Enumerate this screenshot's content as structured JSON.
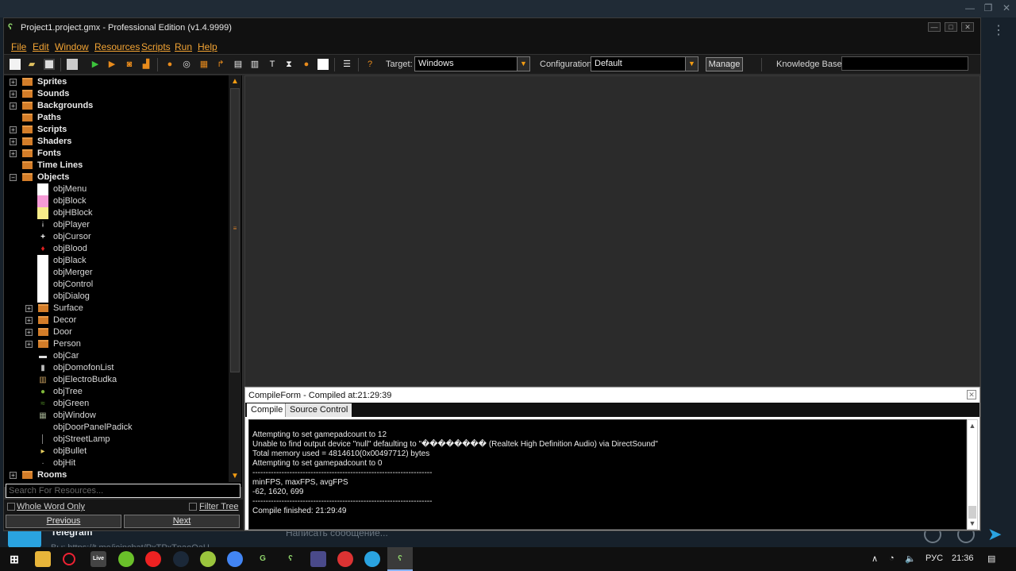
{
  "background_window": {
    "telegram_title": "Telegram",
    "telegram_link": "Вы: https://t.me/joinchat/PxTPxTpaoQaU",
    "message_placeholder": "Написать сообщение...",
    "control_minimize": "—",
    "control_maximize": "❐",
    "control_close": "✕",
    "kebab": "⋮",
    "send": "➤"
  },
  "gm_window": {
    "title": "Project1.project.gmx  -  Professional Edition (v1.4.9999)",
    "logo": "ʕ",
    "btn_minimize": "—",
    "btn_maximize": "□",
    "btn_close": "✕"
  },
  "menu": [
    "File",
    "Edit",
    "Window",
    "Resources",
    "Scripts",
    "Run",
    "Help"
  ],
  "toolbar": {
    "target_label": "Target:",
    "target_value": "Windows",
    "config_label": "Configuration:",
    "config_value": "Default",
    "manage_label": "Manage",
    "kb_label": "Knowledge Base:",
    "dropdown_arrow": "▼"
  },
  "tree": {
    "expand": "+",
    "collapse": "−",
    "folders": [
      "Sprites",
      "Sounds",
      "Backgrounds",
      "Paths",
      "Scripts",
      "Shaders",
      "Fonts",
      "Time Lines",
      "Objects"
    ],
    "objects": [
      "objMenu",
      "objBlock",
      "objHBlock",
      "objPlayer",
      "objCursor",
      "objBlood",
      "objBlack",
      "objMerger",
      "objControl",
      "objDialog"
    ],
    "subfolders": [
      "Surface",
      "Decor",
      "Door",
      "Person"
    ],
    "objects2": [
      "objCar",
      "objDomofonList",
      "objElectroBudka",
      "objTree",
      "objGreen",
      "objWindow",
      "objDoorPanelPadick",
      "objStreetLamp",
      "objBullet",
      "objHit"
    ],
    "rooms": "Rooms",
    "scroll_up": "▲",
    "scroll_down": "▼",
    "grip": "≡"
  },
  "search": {
    "placeholder": "Search For Resources...",
    "whole_word": "Whole Word Only",
    "filter_tree": "Filter Tree",
    "previous": "Previous",
    "next": "Next"
  },
  "compile": {
    "title": "CompileForm - Compiled at:21:29:39",
    "close": "✕",
    "tab_compile": "Compile",
    "tab_source": "Source Control",
    "log": "Attempting to set gamepadcount to 12\nUnable to find output device \"null\" defaulting to \"�������� (Realtek High Definition Audio) via DirectSound\"\nTotal memory used = 4814610(0x00497712) bytes\nAttempting to set gamepadcount to 0\n--------------------------------------------------------------------\nminFPS, maxFPS, avgFPS\n-62, 1620, 699\n--------------------------------------------------------------------\nCompile finished: 21:29:49",
    "scroll_up": "▲",
    "scroll_down": "▼"
  },
  "taskbar": {
    "lang": "РУС",
    "time": "21:36",
    "chevron": "∧",
    "wifi": "◔",
    "volume": "🔈",
    "notifications": "▤"
  },
  "colors": {
    "menu_accent": "#f3a434",
    "folder": "#d37d29",
    "gm_logo": "#8fd46b",
    "telegram": "#2aa3e0"
  }
}
